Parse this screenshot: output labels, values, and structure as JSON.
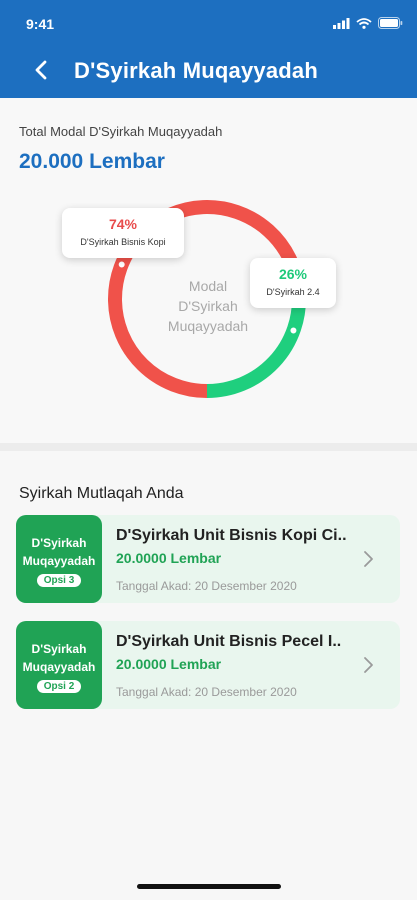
{
  "status_bar": {
    "time": "9:41"
  },
  "header": {
    "title": "D'Syirkah Muqayyadah"
  },
  "summary": {
    "label": "Total Modal D'Syirkah Muqayyadah",
    "value": "20.000 Lembar"
  },
  "chart_data": {
    "type": "pie",
    "center_text": [
      "Modal",
      "D'Syirkah",
      "Muqayyadah"
    ],
    "series": [
      {
        "name": "D'Syirkah Bisnis Kopi",
        "value": 74,
        "label": "74%",
        "color": "#f0524a"
      },
      {
        "name": "D'Syirkah 2.4",
        "value": 26,
        "label": "26%",
        "color": "#1fcf7e"
      }
    ]
  },
  "section": {
    "title": "Syirkah Mutlaqah Anda"
  },
  "cards": [
    {
      "badge_line1": "D'Syirkah",
      "badge_line2": "Muqayyadah",
      "opsi": "Opsi 3",
      "title": "D'Syirkah Unit Bisnis Kopi Ci..",
      "amount": "20.0000 Lembar",
      "date": "Tanggal Akad: 20 Desember 2020"
    },
    {
      "badge_line1": "D'Syirkah",
      "badge_line2": "Muqayyadah",
      "opsi": "Opsi 2",
      "title": "D'Syirkah Unit Bisnis Pecel I..",
      "amount": "20.0000 Lembar",
      "date": "Tanggal Akad: 20 Desember 2020"
    }
  ],
  "icons": {
    "back": "chevron-left-icon",
    "chevron": "chevron-right-icon",
    "signal": "signal-icon",
    "wifi": "wifi-icon",
    "battery": "battery-icon"
  }
}
